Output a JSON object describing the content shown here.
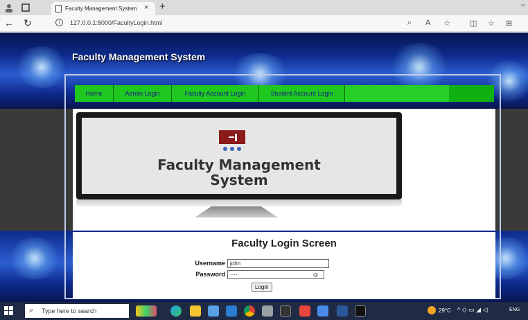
{
  "browser": {
    "tab_title": "Faculty Management System",
    "tab_close": "×",
    "new_tab": "+",
    "url": "127.0.0.1:8000/FacultyLogin.html",
    "icons": [
      "back-icon",
      "refresh-icon",
      "info-icon",
      "read-aloud-icon",
      "favorites-icon",
      "split-screen-icon",
      "collections-icon"
    ]
  },
  "site": {
    "title": "Faculty Management System",
    "nav": [
      "Home",
      "Admin Login",
      "Faculty Account Login",
      "Student Account Login"
    ],
    "banner_line1": "Faculty Management",
    "banner_line2": "System"
  },
  "login": {
    "heading": "Faculty Login Screen",
    "username_label": "Username",
    "username_value": "john",
    "password_label": "Password",
    "password_value": "····",
    "button": "Login"
  },
  "taskbar": {
    "search_placeholder": "Type here to search",
    "temperature": "29°C",
    "language": "ENG"
  },
  "colors": {
    "nav_green": "#1ec81e",
    "nav_text": "#1a1a8a",
    "header_blue": "#0d2a8c",
    "logo_red": "#8b1a1a"
  }
}
